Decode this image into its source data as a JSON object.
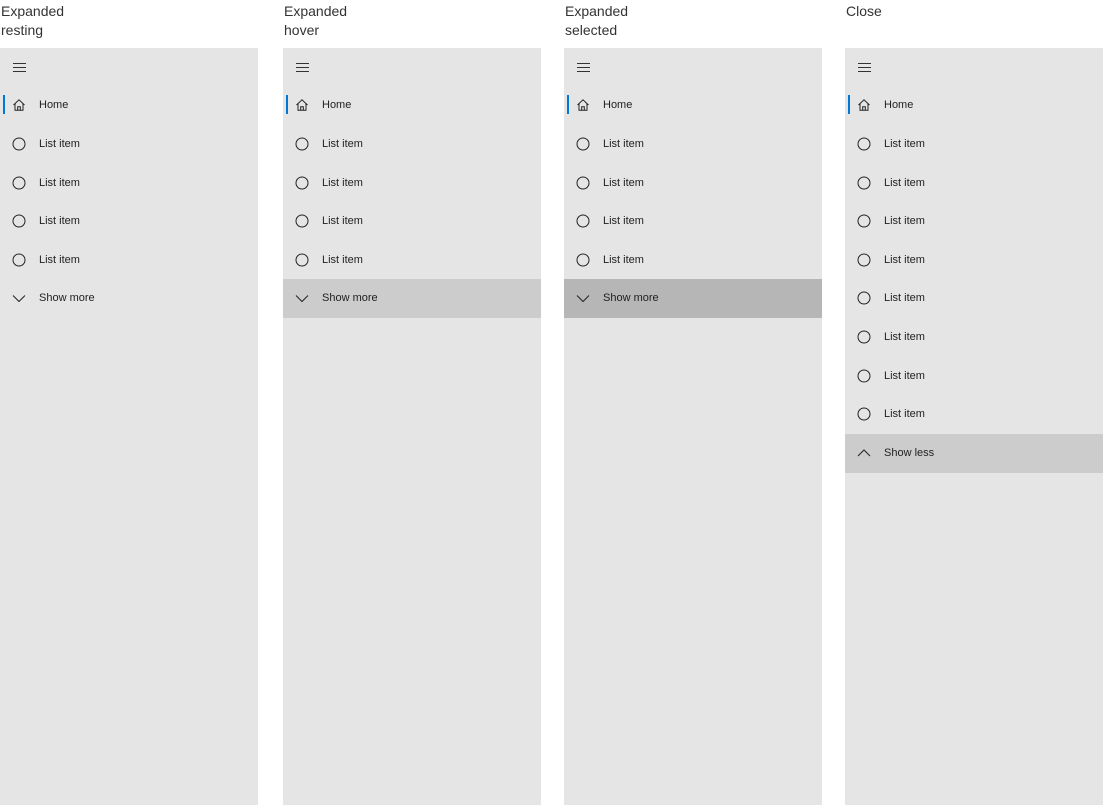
{
  "panels": [
    {
      "caption_line1": "Expanded",
      "caption_line2": "resting",
      "home_label": "Home",
      "items": [
        "List item",
        "List item",
        "List item",
        "List item"
      ],
      "toggle_label": "Show more",
      "toggle_state": "rest",
      "toggle_icon": "chevron-down-icon"
    },
    {
      "caption_line1": "Expanded",
      "caption_line2": "hover",
      "home_label": "Home",
      "items": [
        "List item",
        "List item",
        "List item",
        "List item"
      ],
      "toggle_label": "Show more",
      "toggle_state": "hover",
      "toggle_icon": "chevron-down-icon"
    },
    {
      "caption_line1": "Expanded",
      "caption_line2": "selected",
      "home_label": "Home",
      "items": [
        "List item",
        "List item",
        "List item",
        "List item"
      ],
      "toggle_label": "Show more",
      "toggle_state": "pressed",
      "toggle_icon": "chevron-down-icon"
    },
    {
      "caption_line1": "Close",
      "caption_line2": "",
      "home_label": "Home",
      "items": [
        "List item",
        "List item",
        "List item",
        "List item",
        "List item",
        "List item",
        "List item",
        "List item"
      ],
      "toggle_label": "Show less",
      "toggle_state": "hover",
      "toggle_icon": "chevron-up-icon"
    }
  ],
  "colors": {
    "pane_background": "#e5e5e5",
    "hover_background": "#cccccc",
    "pressed_background": "#b6b6b6",
    "selection_accent": "#0078d7"
  },
  "icons": {
    "menu": "hamburger-menu-icon",
    "home": "home-icon",
    "list_item": "circle-icon"
  }
}
